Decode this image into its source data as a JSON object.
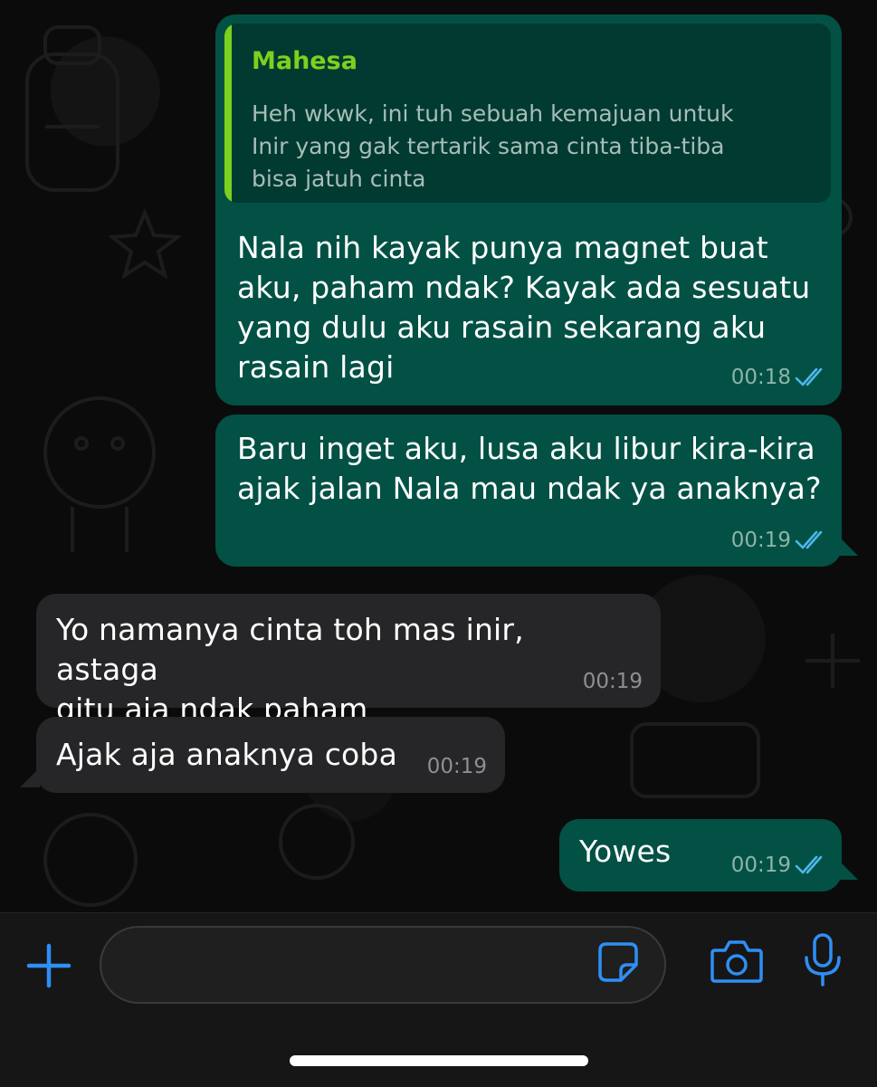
{
  "messages": [
    {
      "direction": "outgoing",
      "reply_to": {
        "sender": "Mahesa",
        "text": "Heh wkwk, ini tuh sebuah kemajuan untuk\nInir yang gak tertarik sama cinta tiba-tiba\nbisa jatuh cinta"
      },
      "text": "Nala nih kayak punya magnet buat\naku, paham ndak? Kayak ada sesuatu\nyang dulu aku rasain sekarang aku\nrasain lagi",
      "time": "00:18",
      "status": "read"
    },
    {
      "direction": "outgoing",
      "text": "Baru inget aku, lusa aku libur kira-kira\najak jalan Nala mau ndak ya anaknya?",
      "time": "00:19",
      "status": "read"
    },
    {
      "direction": "incoming",
      "text": "Yo namanya cinta toh mas inir, astaga\ngitu aja ndak paham",
      "time": "00:19"
    },
    {
      "direction": "incoming",
      "text": "Ajak aja anaknya coba",
      "time": "00:19"
    },
    {
      "direction": "outgoing",
      "text": "Yowes",
      "time": "00:19",
      "status": "read"
    }
  ],
  "composer": {
    "placeholder": "",
    "value": "",
    "icons": [
      "plus-icon",
      "sticker-icon",
      "camera-icon",
      "microphone-icon"
    ]
  },
  "colors": {
    "outgoing_bubble": "#025144",
    "incoming_bubble": "#262628",
    "quote_accent": "#7bd11e",
    "read_tick": "#4fb6ec",
    "accent": "#2e8ff5"
  }
}
